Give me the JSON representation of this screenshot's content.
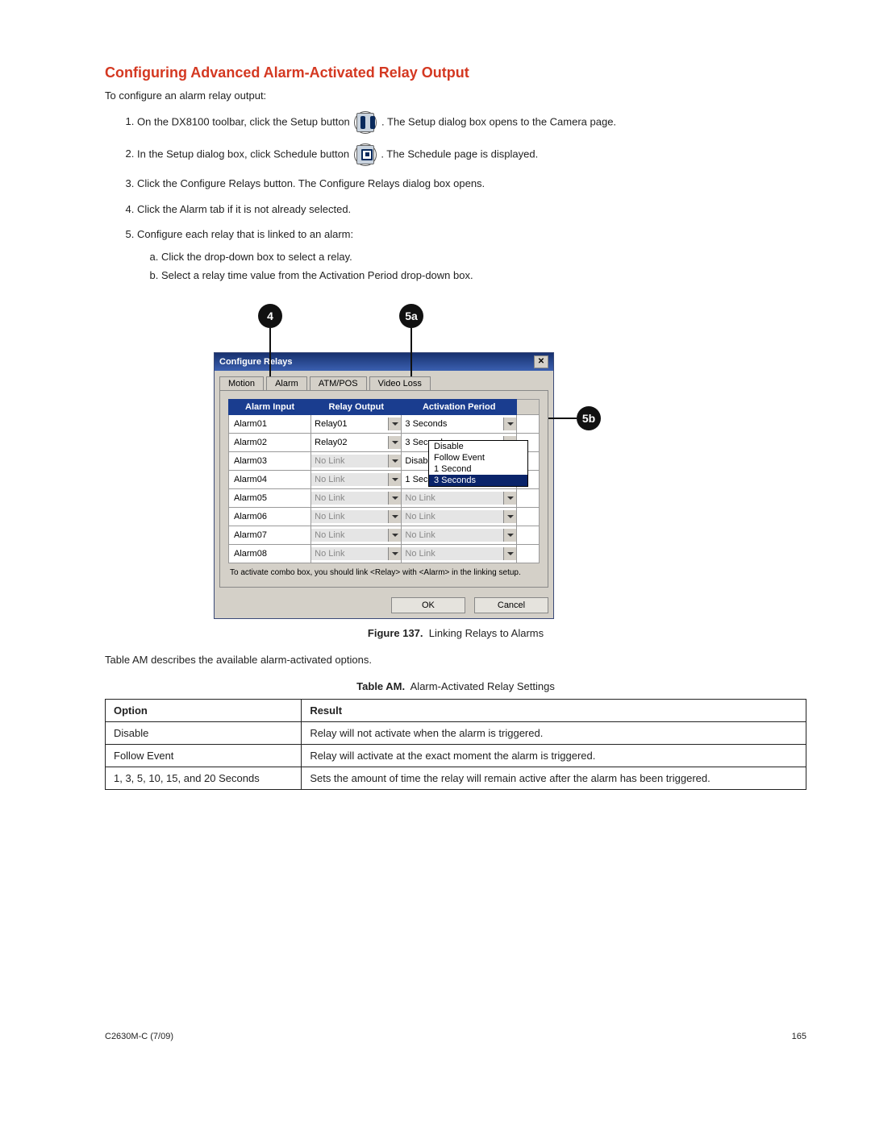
{
  "heading": "Configuring Advanced Alarm-Activated Relay Output",
  "intro": "To configure an alarm relay output:",
  "steps": {
    "s1a": "On the DX8100 toolbar, click the Setup button ",
    "s1b": ". The Setup dialog box opens to the Camera page.",
    "s2a": "In the Setup dialog box, click Schedule button ",
    "s2b": ". The Schedule page is displayed.",
    "s3": "Click the Configure Relays button. The Configure Relays dialog box opens.",
    "s4": "Click the Alarm tab if it is not already selected.",
    "s5": "Configure each relay that is linked to an alarm:",
    "s5a": "Click the drop-down box to select a relay.",
    "s5b": "Select a relay time value from the Activation Period drop-down box."
  },
  "callouts": {
    "c4": "4",
    "c5a": "5a",
    "c5b": "5b"
  },
  "dialog": {
    "title": "Configure Relays",
    "tabs": [
      "Motion",
      "Alarm",
      "ATM/POS",
      "Video Loss"
    ],
    "active_tab": "Alarm",
    "cols": [
      "Alarm Input",
      "Relay Output",
      "Activation Period"
    ],
    "rows": [
      {
        "input": "Alarm01",
        "relay": "Relay01",
        "relay_disabled": false,
        "period": "3 Seconds",
        "period_disabled": false
      },
      {
        "input": "Alarm02",
        "relay": "Relay02",
        "relay_disabled": false,
        "period": "3 Seconds",
        "period_disabled": false
      },
      {
        "input": "Alarm03",
        "relay": "No Link",
        "relay_disabled": true,
        "period": "Disable",
        "period_disabled": false
      },
      {
        "input": "Alarm04",
        "relay": "No Link",
        "relay_disabled": true,
        "period": "1 Second",
        "period_disabled": false
      },
      {
        "input": "Alarm05",
        "relay": "No Link",
        "relay_disabled": true,
        "period": "No Link",
        "period_disabled": true
      },
      {
        "input": "Alarm06",
        "relay": "No Link",
        "relay_disabled": true,
        "period": "No Link",
        "period_disabled": true
      },
      {
        "input": "Alarm07",
        "relay": "No Link",
        "relay_disabled": true,
        "period": "No Link",
        "period_disabled": true
      },
      {
        "input": "Alarm08",
        "relay": "No Link",
        "relay_disabled": true,
        "period": "No Link",
        "period_disabled": true
      }
    ],
    "dropdown_options": [
      "Disable",
      "Follow Event",
      "1 Second",
      "3 Seconds"
    ],
    "dropdown_selected": "3 Seconds",
    "hint": "To activate combo box, you should link <Relay> with <Alarm> in the linking setup.",
    "ok": "OK",
    "cancel": "Cancel"
  },
  "figure": {
    "label": "Figure 137.",
    "text": "Linking Relays to Alarms"
  },
  "table_intro": "Table AM describes the available alarm-activated options.",
  "table_caption": {
    "label": "Table AM.",
    "text": "Alarm-Activated Relay Settings"
  },
  "options_table": {
    "headers": [
      "Option",
      "Result"
    ],
    "rows": [
      [
        "Disable",
        "Relay will not activate when the alarm is triggered."
      ],
      [
        "Follow Event",
        "Relay will activate at the exact moment the alarm is triggered."
      ],
      [
        "1, 3, 5, 10, 15, and 20 Seconds",
        "Sets the amount of time the relay will remain active after the alarm has been triggered."
      ]
    ]
  },
  "footer": {
    "left": "C2630M-C (7/09)",
    "right": "165"
  }
}
